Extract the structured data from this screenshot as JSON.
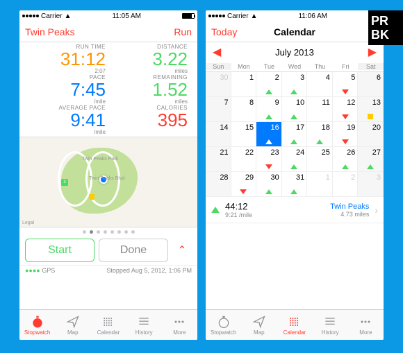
{
  "badge": {
    "line1": "PR",
    "line2": "BK"
  },
  "status": {
    "carrier": "Carrier",
    "time_left": "11:05 AM",
    "time_right": "11:06 AM"
  },
  "stopwatch": {
    "nav_left": "Twin Peaks",
    "nav_right": "Run",
    "metrics": {
      "run_time": {
        "label": "RUN TIME",
        "value": "31:12",
        "sub": "2:07"
      },
      "distance": {
        "label": "DISTANCE",
        "value": "3.22",
        "sub": "miles"
      },
      "pace": {
        "label": "PACE",
        "value": "7:45",
        "sub": "/mile"
      },
      "remaining": {
        "label": "REMAINING",
        "value": "1.52",
        "sub": "miles"
      },
      "avg_pace": {
        "label": "AVERAGE PACE",
        "value": "9:41",
        "sub": "/mile"
      },
      "calories": {
        "label": "CALORIES",
        "value": "395",
        "sub": ""
      }
    },
    "map": {
      "park_label": "Twin Peaks Park",
      "road_label": "Twin Peaks Blvd",
      "legal": "Legal"
    },
    "buttons": {
      "start": "Start",
      "done": "Done"
    },
    "gps_label": "GPS",
    "footer_status": "Stopped Aug 5, 2012, 1:06 PM"
  },
  "calendar": {
    "nav_left": "Today",
    "nav_title": "Calendar",
    "month": "July 2013",
    "weekdays": [
      "Sun",
      "Mon",
      "Tue",
      "Wed",
      "Thu",
      "Fri",
      "Sat"
    ],
    "days": [
      {
        "n": "30",
        "other": true,
        "wknd": true
      },
      {
        "n": "1"
      },
      {
        "n": "2",
        "m": "up"
      },
      {
        "n": "3",
        "m": "up"
      },
      {
        "n": "4"
      },
      {
        "n": "5",
        "m": "down"
      },
      {
        "n": "6",
        "wknd": true
      },
      {
        "n": "7",
        "wknd": true
      },
      {
        "n": "8"
      },
      {
        "n": "9",
        "m": "up"
      },
      {
        "n": "10",
        "m": "up"
      },
      {
        "n": "11"
      },
      {
        "n": "12",
        "m": "down"
      },
      {
        "n": "13",
        "wknd": true,
        "m": "sq"
      },
      {
        "n": "14",
        "wknd": true
      },
      {
        "n": "15"
      },
      {
        "n": "16",
        "today": true,
        "m": "up"
      },
      {
        "n": "17",
        "m": "up"
      },
      {
        "n": "18",
        "m": "up"
      },
      {
        "n": "19",
        "m": "down"
      },
      {
        "n": "20",
        "wknd": true
      },
      {
        "n": "21",
        "wknd": true
      },
      {
        "n": "22"
      },
      {
        "n": "23",
        "m": "down"
      },
      {
        "n": "24",
        "m": "up"
      },
      {
        "n": "25"
      },
      {
        "n": "26",
        "m": "up"
      },
      {
        "n": "27",
        "wknd": true,
        "m": "up"
      },
      {
        "n": "28",
        "wknd": true
      },
      {
        "n": "29",
        "m": "down"
      },
      {
        "n": "30",
        "m": "up"
      },
      {
        "n": "31",
        "m": "up"
      },
      {
        "n": "1",
        "other": true
      },
      {
        "n": "2",
        "other": true
      },
      {
        "n": "3",
        "other": true,
        "wknd": true
      }
    ],
    "run_summary": {
      "time": "44:12",
      "pace": "9:21 /mile",
      "location": "Twin Peaks",
      "distance": "4.73 miles"
    }
  },
  "tabs": {
    "stopwatch": "Stopwatch",
    "map": "Map",
    "calendar": "Calendar",
    "history": "History",
    "more": "More"
  }
}
